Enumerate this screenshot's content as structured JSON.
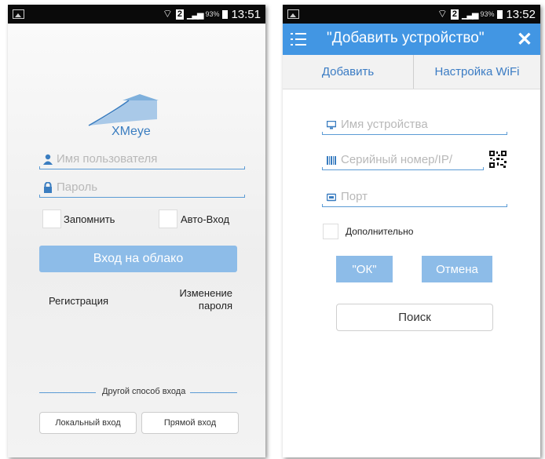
{
  "screen1": {
    "status": {
      "battery": "93%",
      "time": "13:51",
      "sim": "2"
    },
    "brand": "XMeye",
    "username_placeholder": "Имя пользователя",
    "password_placeholder": "Пароль",
    "remember_label": "Запомнить",
    "autologin_label": "Авто-Вход",
    "cloud_login_button": "Вход на облако",
    "register_link": "Регистрация",
    "change_password_line1": "Изменение",
    "change_password_line2": "пароля",
    "other_login_label": "Другой способ входа",
    "local_login_button": "Локальный вход",
    "direct_login_button": "Прямой вход"
  },
  "screen2": {
    "status": {
      "battery": "93%",
      "time": "13:52",
      "sim": "2"
    },
    "title": "\"Добавить устройство\"",
    "tabs": [
      "Добавить",
      "Настройка WiFi"
    ],
    "device_name_placeholder": "Имя устройства",
    "serial_placeholder": "Серийный номер/IP/",
    "port_placeholder": "Порт",
    "advanced_label": "Дополнительно",
    "ok_button": "\"ОК\"",
    "cancel_button": "Отмена",
    "search_button": "Поиск"
  },
  "colors": {
    "accent": "#4296e3",
    "button": "#8dbce8",
    "link": "#3b7cc4"
  },
  "icons": [
    "image-icon",
    "wifi-icon",
    "signal-icon",
    "battery-icon",
    "user-icon",
    "lock-icon",
    "menu-icon",
    "close-icon",
    "monitor-icon",
    "barcode-icon",
    "qr-code-icon",
    "port-icon"
  ]
}
